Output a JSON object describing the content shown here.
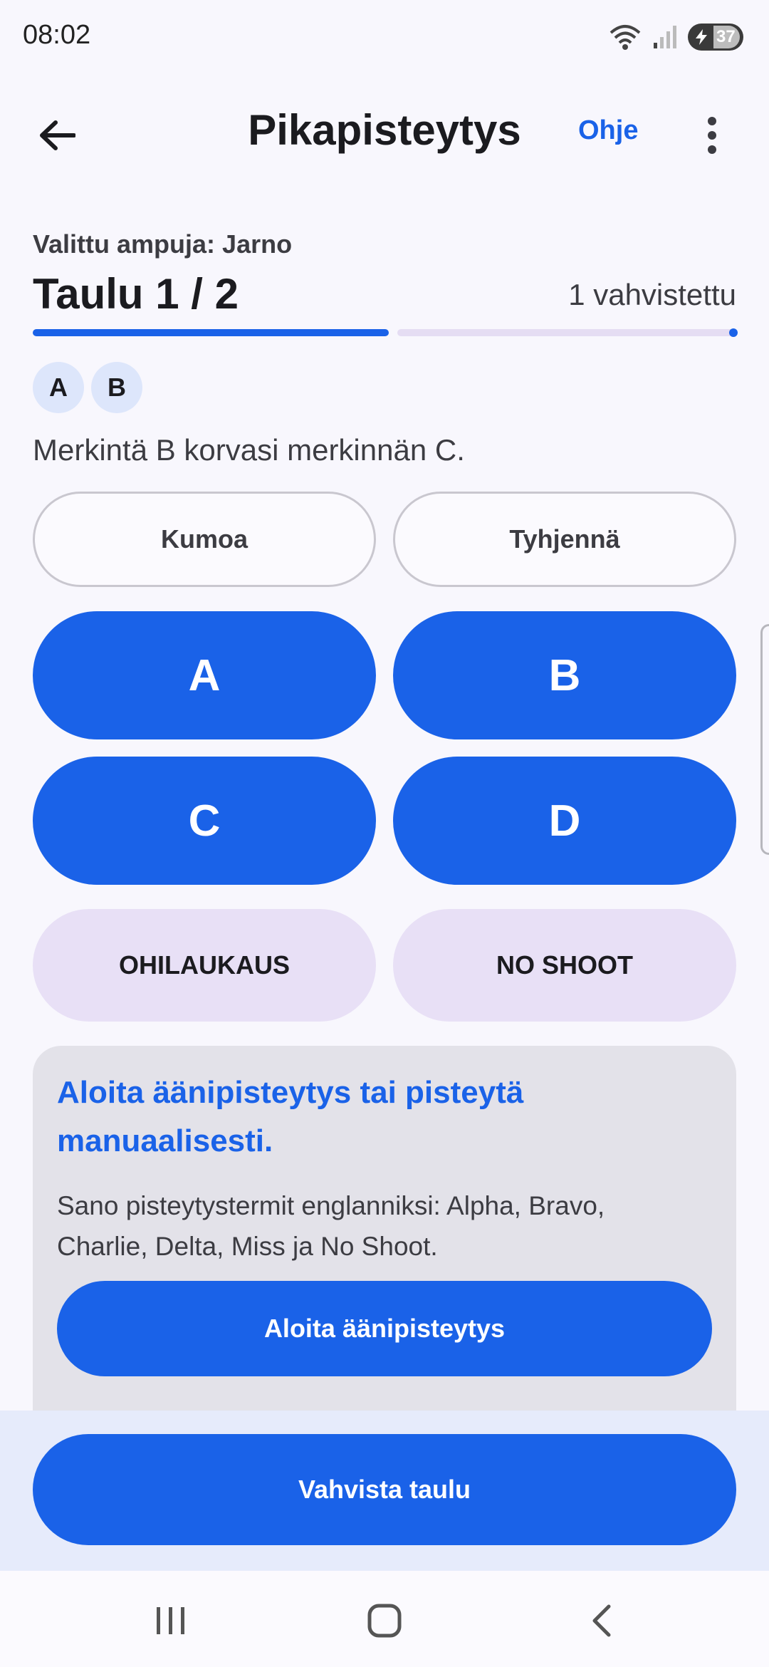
{
  "status_bar": {
    "time": "08:02",
    "battery_level": "37",
    "icons": [
      "wifi-icon",
      "signal-icon",
      "battery-charging-icon"
    ]
  },
  "app_bar": {
    "title": "Pikapisteytys",
    "help_label": "Ohje",
    "icons": [
      "back-arrow-icon",
      "more-vert-icon"
    ]
  },
  "header": {
    "shooter": "Valittu ampuja: Jarno",
    "target": "Taulu 1 / 2",
    "confirmed": "1 vahvistettu",
    "progress_fraction": 0.5
  },
  "entries": [
    "A",
    "B"
  ],
  "message": "Merkintä B korvasi merkinnän C.",
  "actions": {
    "undo": "Kumoa",
    "clear": "Tyhjennä"
  },
  "score_buttons": [
    "A",
    "B",
    "C",
    "D"
  ],
  "secondary_buttons": {
    "miss": "OHILAUKAUS",
    "no_shoot": "NO SHOOT"
  },
  "voice_card": {
    "heading": "Aloita äänipisteytys tai pisteytä manuaalisesti.",
    "description": "Sano pisteytystermit englanniksi: Alpha, Bravo, Charlie, Delta, Miss ja No Shoot.",
    "button": "Aloita äänipisteytys"
  },
  "confirm_button": "Vahvista taulu",
  "colors": {
    "primary": "#1a62e8",
    "tonal": "#e8e0f6",
    "card": "#e3e2e9",
    "background": "#f8f7fd"
  }
}
